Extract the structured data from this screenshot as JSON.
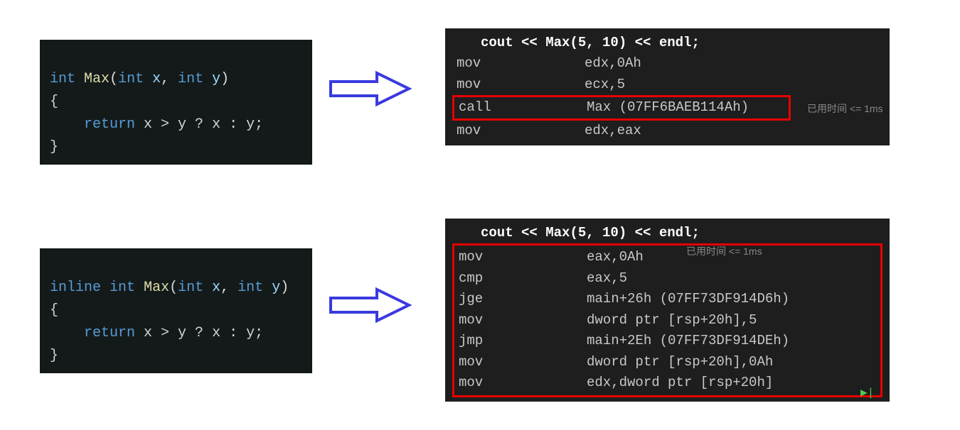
{
  "top": {
    "source": {
      "sig_kw1": "int",
      "sig_fn": "Max",
      "sig_p1kw": "int",
      "sig_p1": "x",
      "sig_p2kw": "int",
      "sig_p2": "y",
      "open": "{",
      "body_kw": "return",
      "body_expr": "x > y ? x : y;",
      "close": "}"
    },
    "asm": {
      "header": "cout << Max(5, 10) << endl;",
      "rows": [
        {
          "mn": "mov",
          "args": "edx,0Ah"
        },
        {
          "mn": "mov",
          "args": "ecx,5"
        },
        {
          "mn": "call",
          "args": "Max (07FF6BAEB114Ah)",
          "highlight": true
        },
        {
          "mn": "mov",
          "args": "edx,eax"
        }
      ]
    },
    "timing": "已用时间 <= 1ms"
  },
  "bottom": {
    "source": {
      "sig_kw0": "inline",
      "sig_kw1": "int",
      "sig_fn": "Max",
      "sig_p1kw": "int",
      "sig_p1": "x",
      "sig_p2kw": "int",
      "sig_p2": "y",
      "open": "{",
      "body_kw": "return",
      "body_expr": "x > y ? x : y;",
      "close": "}"
    },
    "asm": {
      "header": "cout << Max(5, 10) << endl;",
      "rows": [
        {
          "mn": "mov",
          "args": "eax,0Ah"
        },
        {
          "mn": "cmp",
          "args": "eax,5"
        },
        {
          "mn": "jge",
          "args": "main+26h (07FF73DF914D6h)"
        },
        {
          "mn": "mov",
          "args": "dword ptr [rsp+20h],5"
        },
        {
          "mn": "jmp",
          "args": "main+2Eh (07FF73DF914DEh)"
        },
        {
          "mn": "mov",
          "args": "dword ptr [rsp+20h],0Ah"
        },
        {
          "mn": "mov",
          "args": "edx,dword ptr [rsp+20h]"
        }
      ]
    },
    "timing": "已用时间 <= 1ms"
  }
}
